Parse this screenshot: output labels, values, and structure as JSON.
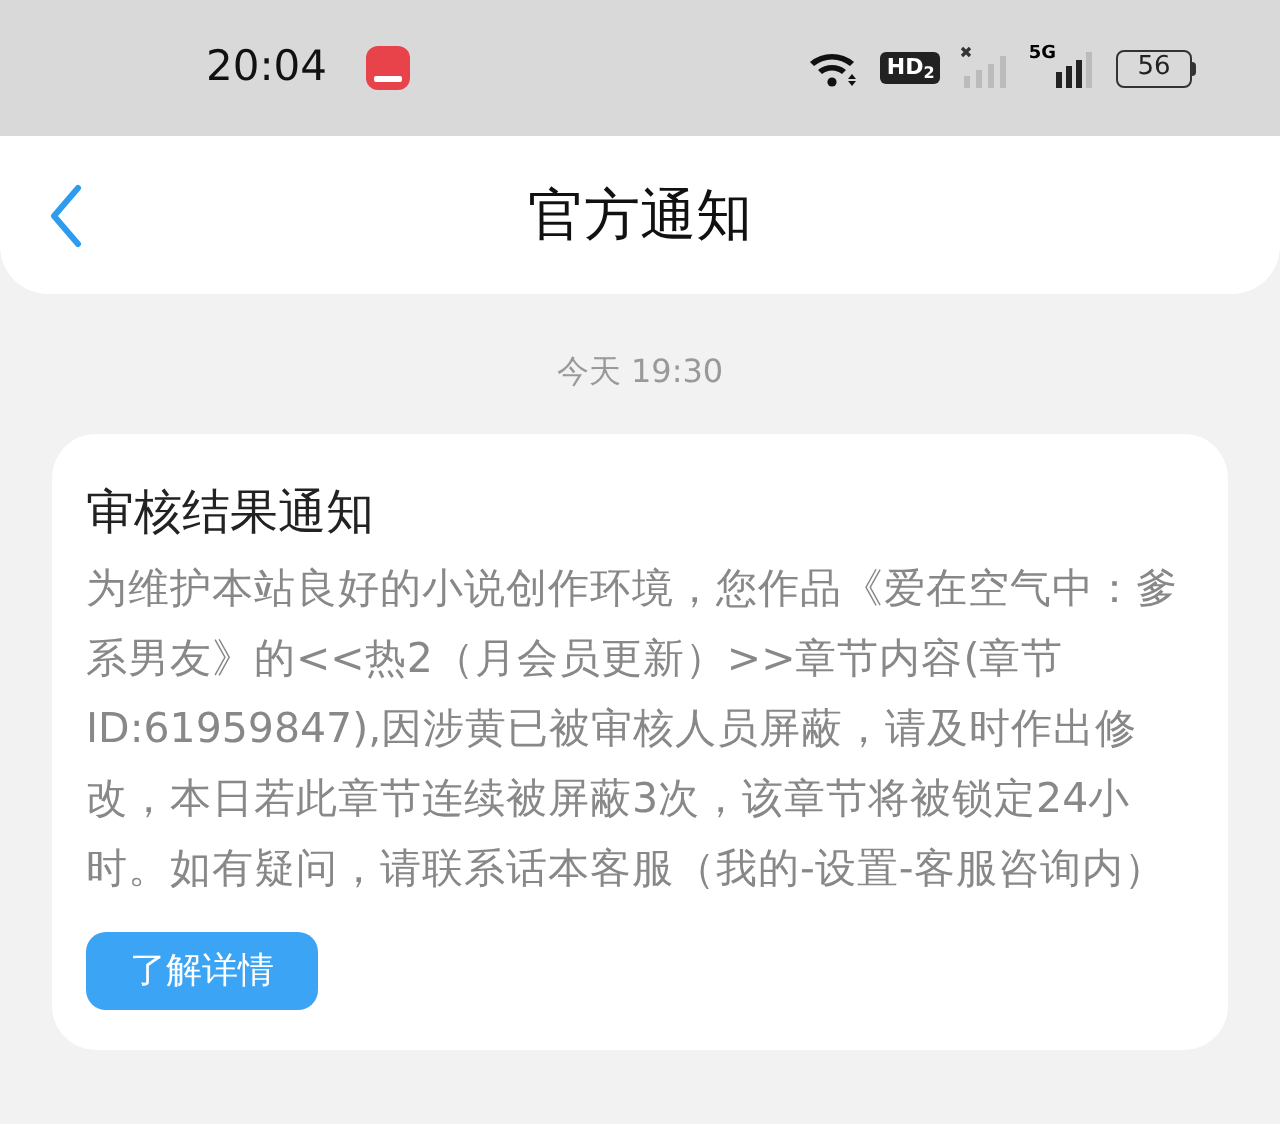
{
  "status_bar": {
    "time": "20:04",
    "hd_badge": "HD",
    "hd_index": "2",
    "network": "5G",
    "battery": "56"
  },
  "header": {
    "title": "官方通知"
  },
  "messages": [
    {
      "time": "今天 19:30",
      "title": "审核结果通知",
      "body": "为维护本站良好的小说创作环境，您作品《爱在空气中：爹系男友》的<<热2（月会员更新）>>章节内容(章节ID:61959847),因涉黄已被审核人员屏蔽，请及时作出修改，本日若此章节连续被屏蔽3次，该章节将被锁定24小时。如有疑问，请联系话本客服（我的-设置-客服咨询内）",
      "button": "了解详情"
    }
  ]
}
